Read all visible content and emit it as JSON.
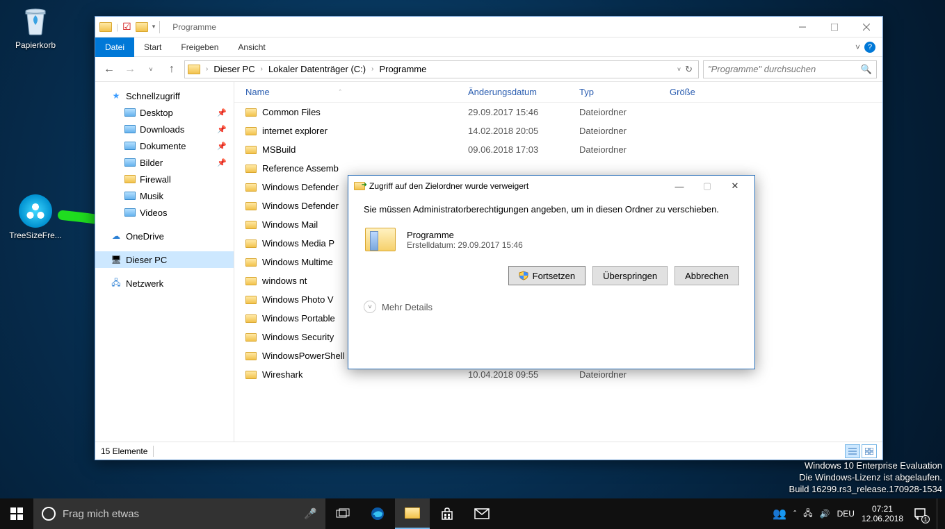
{
  "desktop": {
    "recycle_bin": "Papierkorb",
    "treesize": "TreeSizeFre..."
  },
  "explorer": {
    "title": "Programme",
    "tabs": {
      "file": "Datei",
      "start": "Start",
      "share": "Freigeben",
      "view": "Ansicht"
    },
    "breadcrumbs": [
      "Dieser PC",
      "Lokaler Datenträger (C:)",
      "Programme"
    ],
    "search_placeholder": "\"Programme\" durchsuchen",
    "columns": {
      "name": "Name",
      "date": "Änderungsdatum",
      "type": "Typ",
      "size": "Größe"
    },
    "sidebar": {
      "quick": "Schnellzugriff",
      "quick_items": [
        {
          "label": "Desktop",
          "pin": true
        },
        {
          "label": "Downloads",
          "pin": true
        },
        {
          "label": "Dokumente",
          "pin": true
        },
        {
          "label": "Bilder",
          "pin": true
        },
        {
          "label": "Firewall",
          "pin": false
        },
        {
          "label": "Musik",
          "pin": false
        },
        {
          "label": "Videos",
          "pin": false
        }
      ],
      "onedrive": "OneDrive",
      "this_pc": "Dieser PC",
      "network": "Netzwerk"
    },
    "rows": [
      {
        "name": "Common Files",
        "date": "29.09.2017 15:46",
        "type": "Dateiordner"
      },
      {
        "name": "internet explorer",
        "date": "14.02.2018 20:05",
        "type": "Dateiordner"
      },
      {
        "name": "MSBuild",
        "date": "09.06.2018 17:03",
        "type": "Dateiordner"
      },
      {
        "name": "Reference Assemb",
        "date": "",
        "type": ""
      },
      {
        "name": "Windows Defender",
        "date": "",
        "type": ""
      },
      {
        "name": "Windows Defender",
        "date": "",
        "type": ""
      },
      {
        "name": "Windows Mail",
        "date": "",
        "type": ""
      },
      {
        "name": "Windows Media P",
        "date": "",
        "type": ""
      },
      {
        "name": "Windows Multime",
        "date": "",
        "type": ""
      },
      {
        "name": "windows nt",
        "date": "",
        "type": ""
      },
      {
        "name": "Windows Photo V",
        "date": "",
        "type": ""
      },
      {
        "name": "Windows Portable",
        "date": "",
        "type": ""
      },
      {
        "name": "Windows Security",
        "date": "",
        "type": ""
      },
      {
        "name": "WindowsPowerShell",
        "date": "29.09.2017 15:46",
        "type": "Dateiordner"
      },
      {
        "name": "Wireshark",
        "date": "10.04.2018 09:55",
        "type": "Dateiordner"
      }
    ],
    "status": "15 Elemente"
  },
  "dialog": {
    "title": "Zugriff auf den Zielordner wurde verweigert",
    "message": "Sie müssen Administratorberechtigungen angeben, um in diesen Ordner zu verschieben.",
    "obj_name": "Programme",
    "obj_sub": "Erstelldatum: 29.09.2017 15:46",
    "btn_continue": "Fortsetzen",
    "btn_skip": "Überspringen",
    "btn_cancel": "Abbrechen",
    "more": "Mehr Details"
  },
  "watermark": {
    "l1": "Windows 10 Enterprise Evaluation",
    "l2": "Die Windows-Lizenz ist abgelaufen.",
    "l3": "Build 16299.rs3_release.170928-1534"
  },
  "taskbar": {
    "search": "Frag mich etwas",
    "lang": "DEU",
    "time": "07:21",
    "date": "12.06.2018",
    "notif_count": "1"
  }
}
